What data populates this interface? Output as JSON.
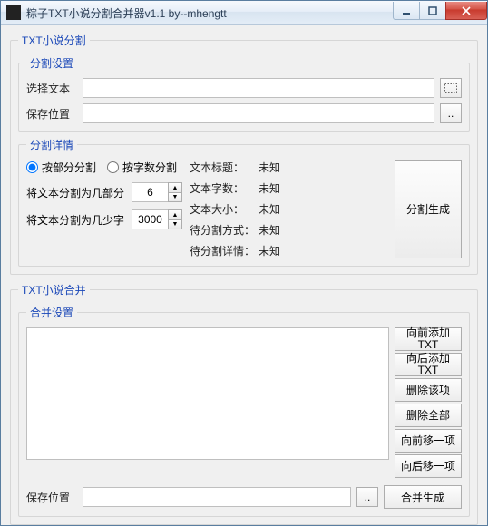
{
  "window": {
    "title": "粽子TXT小说分割合并器v1.1     by--mhengtt",
    "min_tip": "Minimize",
    "max_tip": "Maximize",
    "close_tip": "Close"
  },
  "split": {
    "group_title": "TXT小说分割",
    "settings": {
      "group_title": "分割设置",
      "choose_label": "选择文本",
      "choose_value": "",
      "save_label": "保存位置",
      "save_value": "",
      "browse1": "",
      "browse2": ".."
    },
    "details": {
      "group_title": "分割详情",
      "radio_by_parts": "按部分分割",
      "radio_by_chars": "按字数分割",
      "selected_mode": "parts",
      "parts_label": "将文本分割为几部分",
      "parts_value": "6",
      "chars_label": "将文本分割为几少字",
      "chars_value": "3000",
      "info": {
        "title_k": "文本标题：",
        "title_v": "未知",
        "count_k": "文本字数：",
        "count_v": "未知",
        "size_k": "文本大小：",
        "size_v": "未知",
        "mode_k": "待分割方式：",
        "mode_v": "未知",
        "detail_k": "待分割详情：",
        "detail_v": "未知"
      },
      "generate": "分割生成"
    }
  },
  "merge": {
    "group_title": "TXT小说合并",
    "settings_title": "合并设置",
    "buttons": {
      "prepend": "向前添加TXT",
      "append": "向后添加TXT",
      "remove": "删除该项",
      "clear": "删除全部",
      "move_up": "向前移一项",
      "move_down": "向后移一项"
    },
    "save_label": "保存位置",
    "save_value": "",
    "browse": "..",
    "generate": "合并生成"
  },
  "icons": {
    "browse_dotted": "⋯"
  }
}
